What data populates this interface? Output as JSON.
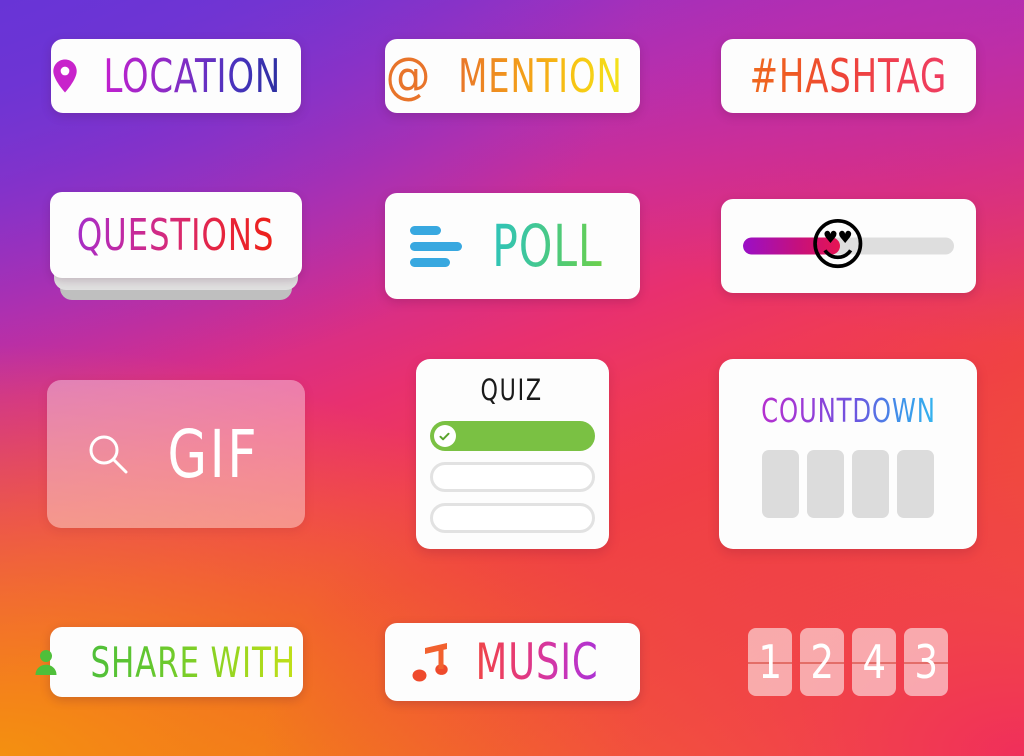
{
  "background": {
    "gradient_colors": [
      "#6a37d6",
      "#a52ec9",
      "#e8306f",
      "#f0463f",
      "#f7a10c"
    ],
    "description": "instagram-gradient"
  },
  "stickers": {
    "location": {
      "label": "LOCATION",
      "icon": "location-pin-icon",
      "icon_color": "#c61fd0",
      "text_gradient": [
        "#c61fd0",
        "#2a2f9e"
      ]
    },
    "mention": {
      "label": "MENTION",
      "at_symbol": "@",
      "icon": "at-symbol-icon",
      "icon_color": "#e8742a",
      "text_gradient": [
        "#e8742a",
        "#f3e61c"
      ]
    },
    "hashtag": {
      "label": "#HASHTAG",
      "text_gradient": [
        "#ef6a1e",
        "#ef3d62"
      ]
    },
    "questions": {
      "label": "QUESTIONS",
      "text_gradient": [
        "#a52ec9",
        "#ee2016"
      ],
      "stack_layers": 2
    },
    "poll": {
      "label": "POLL",
      "icon": "poll-bars-icon",
      "bar_color": "#38a8e0",
      "bars": 3,
      "text_gradient": [
        "#2ec3ba",
        "#6ed04b"
      ]
    },
    "emoji_slider": {
      "emoji": "😍",
      "emoji_name": "smiling-face-with-heart-eyes",
      "fill_percent": 46,
      "fill_gradient": [
        "#9a0fc7",
        "#e61452"
      ],
      "track_color": "#dedede"
    },
    "gif": {
      "label": "GIF",
      "icon": "search-icon",
      "text_color": "#ffffff",
      "card_background": "rgba(255,255,255,0.38)"
    },
    "quiz": {
      "title": "QUIZ",
      "title_color": "#1a1a1a",
      "options": [
        {
          "state": "correct",
          "color": "#7ac143",
          "icon": "checkmark-icon"
        },
        {
          "state": "empty",
          "color": "#e2e2e2"
        },
        {
          "state": "empty",
          "color": "#e2e2e2"
        }
      ]
    },
    "countdown": {
      "label": "COUNTDOWN",
      "text_gradient": [
        "#b72fcf",
        "#33b6ef"
      ],
      "placeholder_boxes": 4,
      "box_color": "#dcdcdc"
    },
    "share_with": {
      "label": "SHARE WITH",
      "icon": "person-icon",
      "icon_color": "#4fbf3a",
      "text_gradient": [
        "#4fbf3a",
        "#c3e018"
      ]
    },
    "music": {
      "label": "MUSIC",
      "icon": "music-note-icon",
      "icon_color": "#ef5a3a",
      "text_gradient": [
        "#ef4646",
        "#a931d4"
      ]
    },
    "flip_clock": {
      "digits": [
        "1",
        "2",
        "4",
        "3"
      ],
      "digit_color": "#ffffff",
      "tile_background": "rgba(255,255,255,0.55)"
    }
  }
}
